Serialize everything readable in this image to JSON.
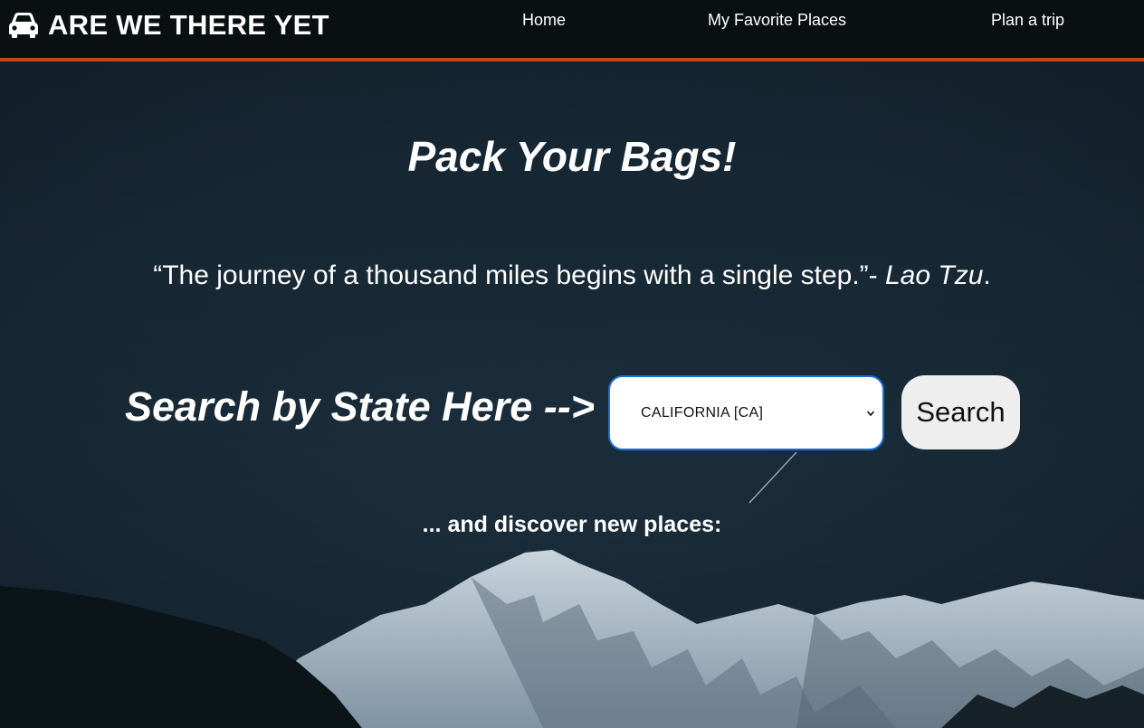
{
  "header": {
    "brand": "ARE WE THERE YET",
    "brand_icon": "car-icon",
    "accent_color": "#c2451e",
    "nav": {
      "home": "Home",
      "favorites": "My Favorite Places",
      "plan": "Plan a trip"
    }
  },
  "hero": {
    "headline": "Pack Your Bags!",
    "quote": {
      "text": "“The journey of a thousand miles begins with a single step.”-",
      "author": "Lao Tzu",
      "end": "."
    },
    "search": {
      "label": "Search by State Here -->",
      "selected_state": "CALIFORNIA [CA]",
      "button": "Search"
    },
    "discover": "... and discover new places:"
  }
}
